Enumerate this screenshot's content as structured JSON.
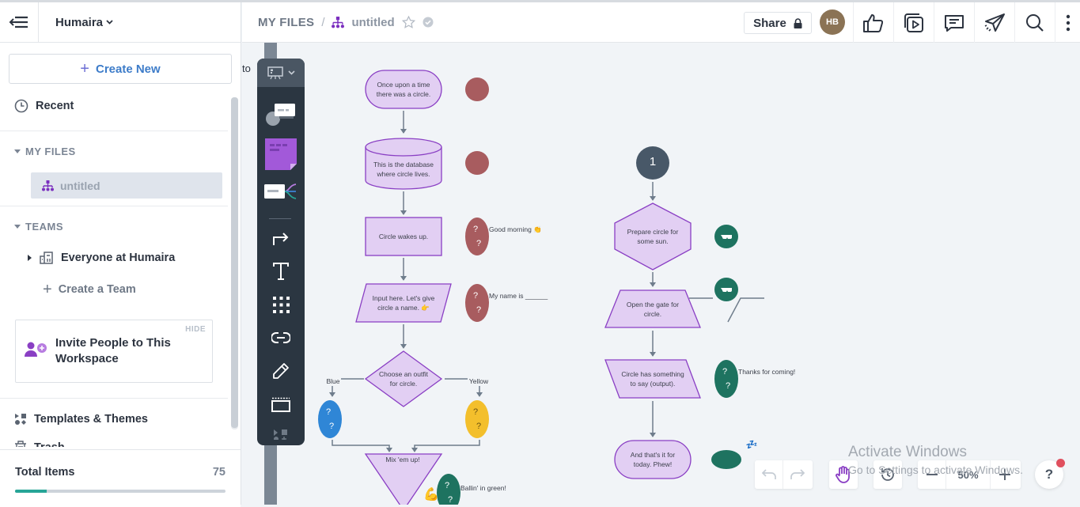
{
  "sidebar": {
    "workspace_name": "Humaira",
    "create_new_label": "Create New",
    "recent_label": "Recent",
    "my_files_header": "MY FILES",
    "files": [
      {
        "name": "untitled",
        "selected": true
      }
    ],
    "teams_header": "TEAMS",
    "teams": [
      {
        "name": "Everyone at Humaira"
      }
    ],
    "create_team_label": "Create a Team",
    "invite_card": {
      "title": "Invite People to This Workspace",
      "hide_label": "HIDE"
    },
    "templates_label": "Templates & Themes",
    "trash_label": "Trash",
    "total_items_label": "Total Items",
    "total_items_count": "75",
    "usage_fraction": 0.15
  },
  "topbar": {
    "breadcrumb_root": "MY FILES",
    "breadcrumb_sep": "/",
    "document_title": "untitled",
    "share_label": "Share",
    "avatar_initials": "HB",
    "icons": [
      "thumbs-up-icon",
      "present-icon",
      "comment-icon",
      "send-icon",
      "search-icon",
      "more-vertical-icon"
    ]
  },
  "canvas": {
    "offscreen_text": "to",
    "tools": [
      "shape-library",
      "sticky-note",
      "mind-map",
      "connector",
      "text",
      "grid",
      "link",
      "pencil",
      "frame",
      "more"
    ],
    "flowchart": {
      "left_column": [
        {
          "shape": "terminator",
          "text": [
            "Once upon a time",
            "there was a circle."
          ]
        },
        {
          "shape": "database",
          "text": [
            "This is the database",
            "where circle lives."
          ]
        },
        {
          "shape": "process",
          "text": [
            "Circle wakes up."
          ]
        },
        {
          "shape": "input",
          "text": [
            "Input here. Let's give",
            "circle a name. 👉"
          ]
        },
        {
          "shape": "decision",
          "text": [
            "Choose an outfit",
            "for circle."
          ]
        },
        {
          "shape": "merge",
          "text": [
            "Mix 'em up!"
          ]
        }
      ],
      "branch_labels": {
        "left": "Blue",
        "right": "Yellow"
      },
      "right_column": [
        {
          "shape": "start-badge",
          "text": [
            "1"
          ]
        },
        {
          "shape": "preparation",
          "text": [
            "Prepare circle for",
            "some sun."
          ]
        },
        {
          "shape": "manual-operation",
          "text": [
            "Open the gate for",
            "circle."
          ]
        },
        {
          "shape": "output",
          "text": [
            "Circle has something",
            "to say (output)."
          ]
        },
        {
          "shape": "terminator",
          "text": [
            "And that's it for",
            "today. Phew!"
          ]
        }
      ],
      "annotations": {
        "good_morning": "Good morning 👏",
        "my_name": "My name is ______",
        "ballin": "Ballin' in green!",
        "thanks": "Thanks for coming!",
        "question_marks": "?"
      },
      "colors": {
        "shape_fill": "#e2cff3",
        "shape_stroke": "#8a3fc4",
        "connector": "#6f7d8c",
        "red_circle": "#a85c5f",
        "blue_circle": "#2f86d6",
        "yellow_circle": "#f3bf2c",
        "green_circle": "#1e7360",
        "badge": "#485868"
      }
    }
  },
  "controls": {
    "zoom_level": "50%",
    "help_label": "?"
  },
  "watermark": {
    "line1": "Activate Windows",
    "line2": "Go to Settings to activate Windows."
  }
}
